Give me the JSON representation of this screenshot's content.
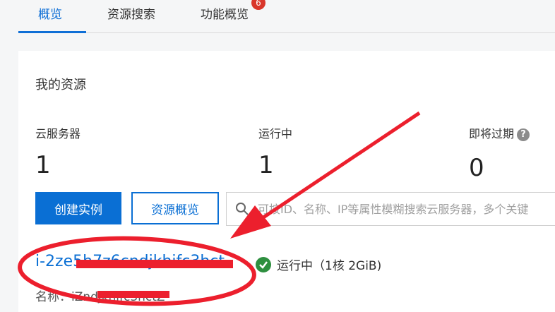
{
  "tabs": [
    {
      "label": "概览",
      "active": true
    },
    {
      "label": "资源搜索"
    },
    {
      "label": "功能概览",
      "badge": "6"
    }
  ],
  "section_title": "我的资源",
  "stats": [
    {
      "label": "云服务器",
      "value": "1"
    },
    {
      "label": "运行中",
      "value": "1"
    },
    {
      "label": "即将过期",
      "value": "0",
      "help_icon": "question-circle-icon"
    }
  ],
  "buttons": {
    "create": "创建实例",
    "overview": "资源概览"
  },
  "search": {
    "icon": "search-icon",
    "placeholder": "可按ID、名称、IP等属性模糊搜索云服务器，多个关键"
  },
  "instance": {
    "id": "i-2ze5h7z6cndjkhifc3hct",
    "status_icon": "check-circle-icon",
    "status": "运行中（1核 2GiB)",
    "name_label": "名称：",
    "name": "iZndjkhifc3hctZ"
  },
  "colors": {
    "accent": "#0a6fd4",
    "annotation_red": "#ec1f2d",
    "success": "#2e8f3f"
  }
}
